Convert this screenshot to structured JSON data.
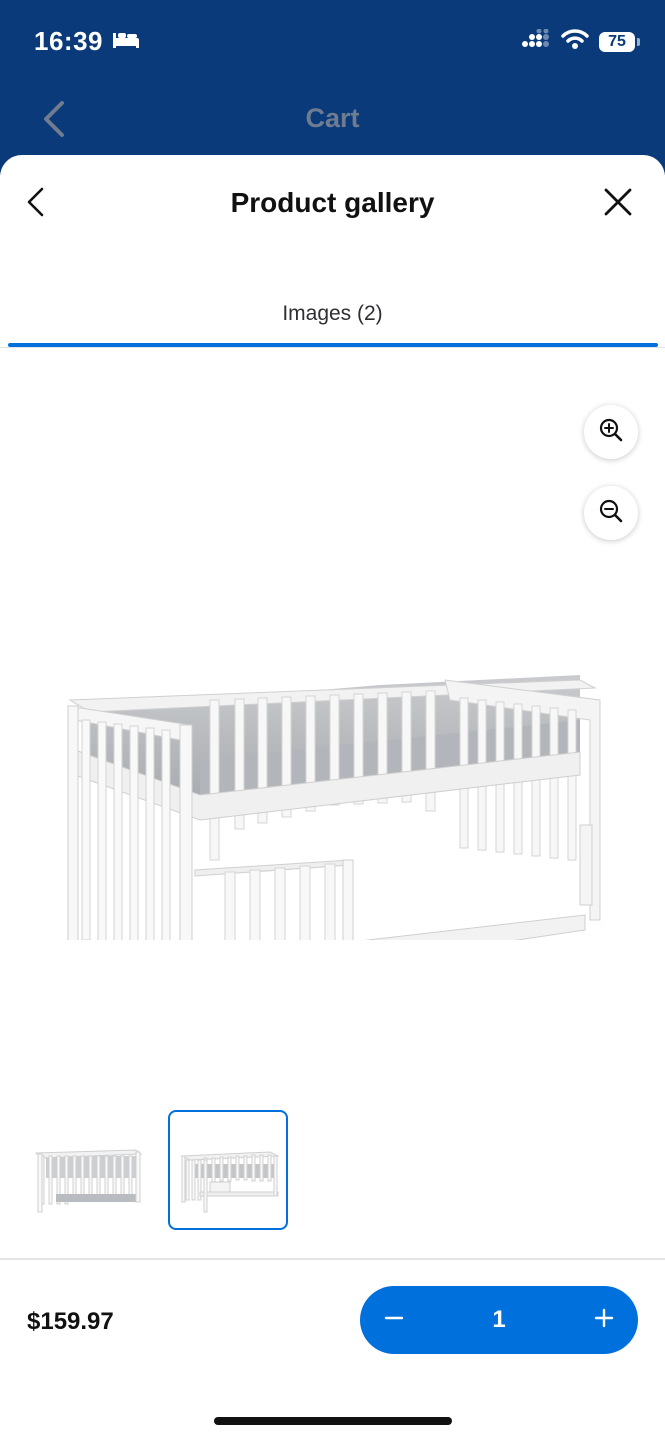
{
  "status_bar": {
    "time": "16:39",
    "battery": "75",
    "icons": [
      "bed-icon",
      "signal-icon",
      "wifi-icon",
      "battery-icon"
    ]
  },
  "background_header": {
    "title": "Cart",
    "back_icon": "chevron-left-icon"
  },
  "sheet": {
    "title": "Product gallery",
    "back_icon": "chevron-left-icon",
    "close_icon": "close-icon",
    "tabs": [
      {
        "label": "Images (2)",
        "selected": true
      }
    ]
  },
  "gallery": {
    "zoom_in_icon": "zoom-in-icon",
    "zoom_out_icon": "zoom-out-icon",
    "thumbnails": [
      {
        "selected": false
      },
      {
        "selected": true
      }
    ]
  },
  "footer": {
    "price": "$159.97",
    "quantity": "1",
    "decrement_icon": "minus-icon",
    "increment_icon": "plus-icon"
  },
  "colors": {
    "header_blue": "#0a3a7a",
    "accent": "#0071dc"
  }
}
